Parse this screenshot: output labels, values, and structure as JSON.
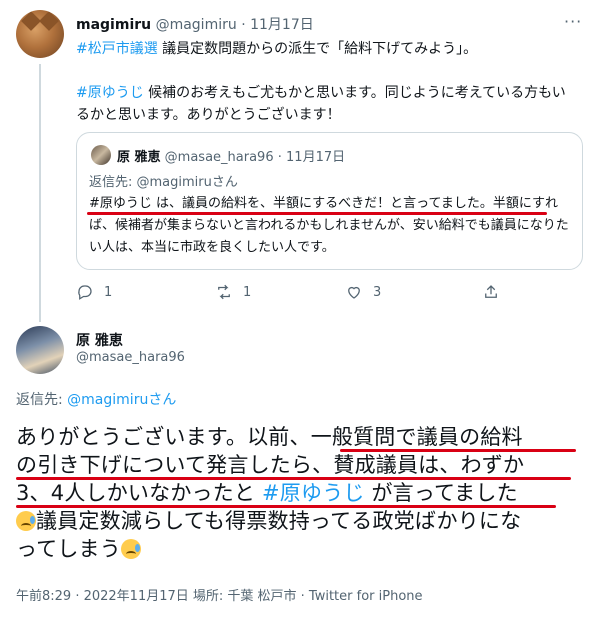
{
  "top_tweet": {
    "name": "magimiru",
    "handle": "@magimiru",
    "dot": "·",
    "date": "11月17日",
    "more": "···",
    "line1_hashtag": "#松戸市議選",
    "line1_text": " 議員定数問題からの派生で「給料下げてみよう」。",
    "line2_hashtag": "#原ゆうじ",
    "line2_text": " 候補のお考えもご尤もかと思います。同じように考えている方もいるかと思います。ありがとうございます！"
  },
  "quoted_tweet": {
    "name": "原 雅恵",
    "handle": "@masae_hara96",
    "dot": "·",
    "date": "11月17日",
    "reply_prefix": "返信先: ",
    "reply_handle": "@magimiruさん",
    "body": "#原ゆうじ は、議員の給料を、半額にするべきだ！と言ってました。半額にすれば、候補者が集まらないと言われるかもしれませんが、安い給料でも議員になりたい人は、本当に市政を良くしたい人です。"
  },
  "actions": {
    "reply_count": "1",
    "retweet_count": "1",
    "like_count": "3"
  },
  "main_tweet": {
    "name": "原 雅恵",
    "handle": "@masae_hara96",
    "reply_prefix": "返信先: ",
    "reply_handle": "@magimiruさん",
    "line1": "ありがとうございます。以前、一般質問で議員の給料",
    "line2": "の引き下げについて発言したら、賛成議員は、わずか",
    "line3_a": "3、4人しかいなかったと ",
    "line3_hashtag": "#原ゆうじ",
    "line3_b": " が言ってました",
    "line4": "議員定数減らしても得票数持ってる政党ばかりにな",
    "line5": "ってしまう",
    "meta": "午前8:29 · 2022年11月17日 場所: 千葉 松戸市 · Twitter for iPhone"
  },
  "colors": {
    "link": "#1d9bf0",
    "secondary": "#536471",
    "underline": "#d90014"
  }
}
